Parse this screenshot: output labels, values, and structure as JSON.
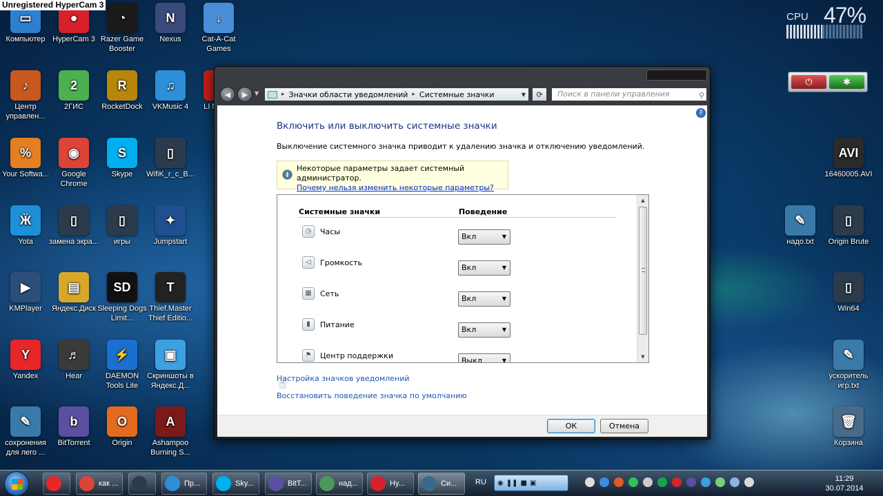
{
  "watermark": "Unregistered HyperCam 3",
  "cpu_widget": {
    "label": "CPU",
    "value": "47%",
    "level_percent": 47
  },
  "desktop_icons": [
    {
      "label": "Компьютер",
      "icon": "computer-icon",
      "color": "#2f7fd0",
      "glyph": "▭"
    },
    {
      "label": "HyperCam 3",
      "icon": "hypercam-icon",
      "color": "#d8202a",
      "glyph": "●"
    },
    {
      "label": "Razer Game Booster",
      "icon": "razer-icon",
      "color": "#1a1a1a",
      "glyph": "◔"
    },
    {
      "label": "Nexus",
      "icon": "nexus-icon",
      "color": "#3a4a7a",
      "glyph": "N"
    },
    {
      "label": "Cat-A-Cat Games",
      "icon": "catacat-icon",
      "color": "#4a8ed8",
      "glyph": "↓"
    },
    {
      "label": "Центр управлен...",
      "icon": "guitar-icon",
      "color": "#c8581e",
      "glyph": "♪"
    },
    {
      "label": "2ГИС",
      "icon": "2gis-icon",
      "color": "#4caf50",
      "glyph": "2"
    },
    {
      "label": "RocketDock",
      "icon": "rocketdock-icon",
      "color": "#b8860b",
      "glyph": "R"
    },
    {
      "label": "VKMusic 4",
      "icon": "vkmusic-icon",
      "color": "#2d8fd8",
      "glyph": "♫"
    },
    {
      "label": "LI MARV",
      "icon": "lego-icon",
      "color": "#c41e1e",
      "glyph": "L"
    },
    {
      "label": "Your Softwa...",
      "icon": "cart-icon",
      "color": "#e67e22",
      "glyph": "%"
    },
    {
      "label": "Google Chrome",
      "icon": "chrome-icon",
      "color": "#db4437",
      "glyph": "◉"
    },
    {
      "label": "Skype",
      "icon": "skype-icon",
      "color": "#00aff0",
      "glyph": "S"
    },
    {
      "label": "WifiK_r_c_B...",
      "icon": "file-icon",
      "color": "#2b3b4b",
      "glyph": "▯"
    },
    {
      "label": "Yota",
      "icon": "yota-icon",
      "color": "#1e90d8",
      "glyph": "Ӝ"
    },
    {
      "label": "замена экра...",
      "icon": "file-icon",
      "color": "#2b3b4b",
      "glyph": "▯"
    },
    {
      "label": "игры",
      "icon": "file-icon",
      "color": "#2b3b4b",
      "glyph": "▯"
    },
    {
      "label": "Jumpstart",
      "icon": "jumpstart-icon",
      "color": "#1f4f8f",
      "glyph": "✦"
    },
    {
      "label": "KMPlayer",
      "icon": "kmplayer-icon",
      "color": "#2c4f7a",
      "glyph": "▶"
    },
    {
      "label": "Яндекс.Диск",
      "icon": "folder-icon",
      "color": "#d8a72a",
      "glyph": "▤"
    },
    {
      "label": "Sleeping Dogs Limit...",
      "icon": "sleepingdogs-icon",
      "color": "#111",
      "glyph": "SD"
    },
    {
      "label": "Thief.Master Thief Editio...",
      "icon": "thief-icon",
      "color": "#222",
      "glyph": "T"
    },
    {
      "label": "Yandex",
      "icon": "yandex-icon",
      "color": "#e8262a",
      "glyph": "Y"
    },
    {
      "label": "Hear",
      "icon": "hear-icon",
      "color": "#3a3a3a",
      "glyph": "♬"
    },
    {
      "label": "DAEMON Tools Lite",
      "icon": "daemon-icon",
      "color": "#1b6fd1",
      "glyph": "⚡"
    },
    {
      "label": "Скриншоты в Яндекс.Д...",
      "icon": "screenshot-icon",
      "color": "#3fa0e0",
      "glyph": "▣"
    },
    {
      "label": "сохронения для лего ...",
      "icon": "text-file-icon",
      "color": "#3a7aa8",
      "glyph": "✎"
    },
    {
      "label": "BitTorrent",
      "icon": "bittorrent-icon",
      "color": "#5a4fa0",
      "glyph": "b"
    },
    {
      "label": "Origin",
      "icon": "origin-icon",
      "color": "#e26b1e",
      "glyph": "O"
    },
    {
      "label": "Ashampoo Burning S...",
      "icon": "ashampoo-icon",
      "color": "#7a1a1a",
      "glyph": "A"
    },
    {
      "label": "16460005.AVI",
      "icon": "avi-file-icon",
      "color": "#2a2a2a",
      "glyph": "AVI"
    },
    {
      "label": "надо.txt",
      "icon": "text-file-icon",
      "color": "#3a7aa8",
      "glyph": "✎"
    },
    {
      "label": "Origin Brute",
      "icon": "file-icon",
      "color": "#2b3b4b",
      "glyph": "▯"
    },
    {
      "label": "Win64",
      "icon": "file-icon",
      "color": "#2b3b4b",
      "glyph": "▯"
    },
    {
      "label": "ускоритель игр.txt",
      "icon": "text-file-icon",
      "color": "#3a7aa8",
      "glyph": "✎"
    },
    {
      "label": "Корзина",
      "icon": "recycle-bin-icon",
      "color": "#4a6a8a",
      "glyph": "🗑"
    }
  ],
  "window": {
    "address": {
      "part1": "Значки области уведомлений",
      "part2": "Системные значки"
    },
    "search_placeholder": "Поиск в панели управления",
    "title": "Включить или выключить системные значки",
    "description": "Выключение системного значка приводит к удалению значка и отключению уведомлений.",
    "info": {
      "text": "Некоторые параметры задает системный администратор.",
      "link": "Почему нельзя изменить некоторые параметры?"
    },
    "table": {
      "col_icons": "Системные значки",
      "col_behavior": "Поведение",
      "rows": [
        {
          "name": "Часы",
          "value": "Вкл",
          "icon": "clock-icon",
          "glyph": "◷"
        },
        {
          "name": "Громкость",
          "value": "Вкл",
          "icon": "volume-icon",
          "glyph": "◁"
        },
        {
          "name": "Сеть",
          "value": "Вкл",
          "icon": "network-icon",
          "glyph": "▦"
        },
        {
          "name": "Питание",
          "value": "Вкл",
          "icon": "power-icon",
          "glyph": "▮"
        },
        {
          "name": "Центр поддержки",
          "value": "Выкл",
          "icon": "flag-icon",
          "glyph": "⚑"
        }
      ]
    },
    "link_customize": "Настройка значков уведомлений",
    "link_restore": "Восстановить поведение значка по умолчанию",
    "ok": "ОК",
    "cancel": "Отмена"
  },
  "taskbar": {
    "items": [
      {
        "label": "",
        "icon": "yandex-browser-icon",
        "color": "#e8262a"
      },
      {
        "label": "как ...",
        "icon": "chrome-icon",
        "color": "#db4437"
      },
      {
        "label": "",
        "icon": "monitor-icon",
        "color": "#2b3b4b"
      },
      {
        "label": "Пр...",
        "icon": "media-icon",
        "color": "#2c8fd8"
      },
      {
        "label": "Sky...",
        "icon": "skype-icon",
        "color": "#00aff0"
      },
      {
        "label": "BitT...",
        "icon": "bittorrent-icon",
        "color": "#5a4fa0"
      },
      {
        "label": "над...",
        "icon": "notepad-icon",
        "color": "#4a9a5a"
      },
      {
        "label": "Hy...",
        "icon": "hypercam-icon",
        "color": "#d8202a"
      },
      {
        "label": "Си...",
        "icon": "control-panel-icon",
        "color": "#3a6a8a"
      }
    ],
    "lang": "RU",
    "time": "11:29",
    "date": "30.07.2014"
  }
}
